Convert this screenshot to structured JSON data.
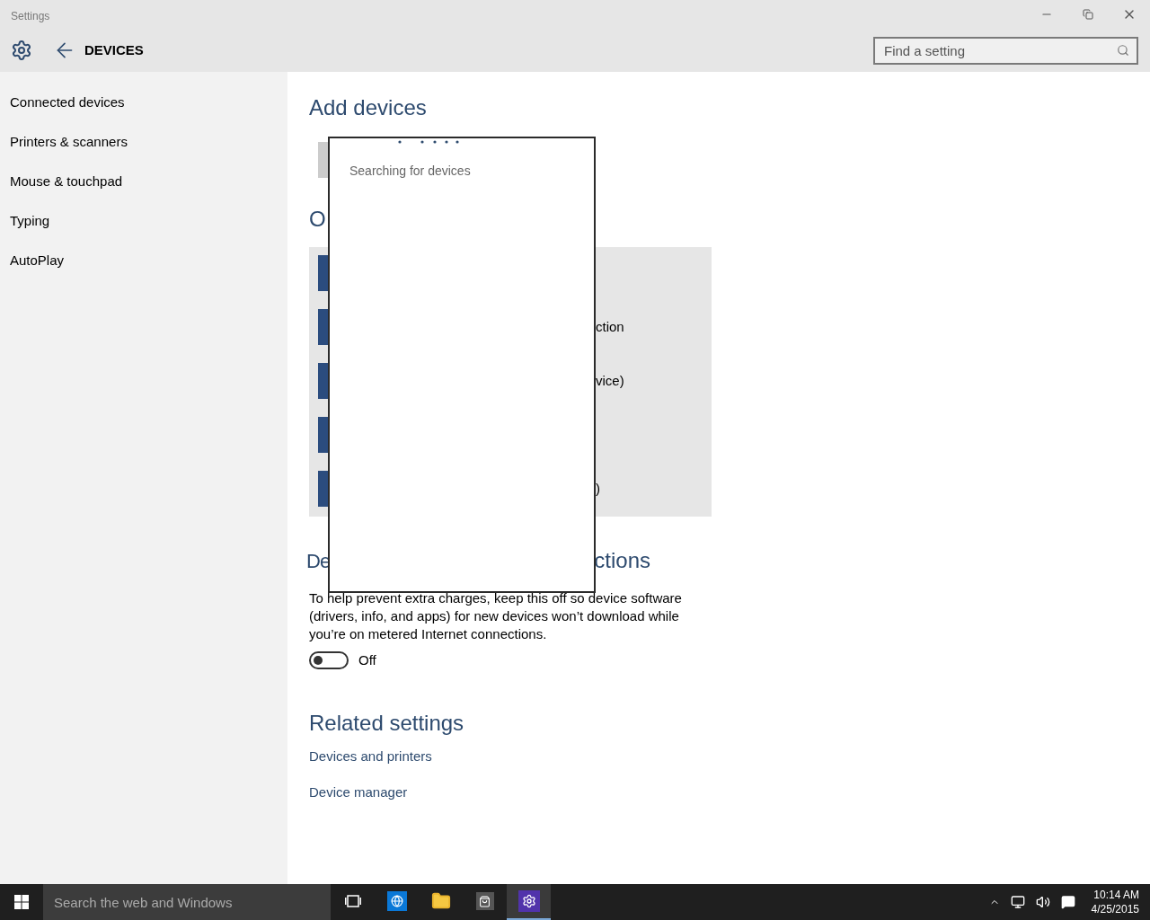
{
  "window": {
    "title": "Settings"
  },
  "header": {
    "title": "DEVICES"
  },
  "search": {
    "placeholder": "Find a setting"
  },
  "sidebar": {
    "items": [
      {
        "label": "Connected devices",
        "selected": false
      },
      {
        "label": "Printers & scanners",
        "selected": false
      },
      {
        "label": "Mouse & touchpad",
        "selected": false
      },
      {
        "label": "Typing",
        "selected": false
      },
      {
        "label": "AutoPlay",
        "selected": false
      }
    ]
  },
  "content": {
    "add_devices": {
      "title": "Add devices"
    },
    "other_devices": {
      "title": "O",
      "rows": [
        {},
        {
          "text": "ction"
        },
        {
          "text": "vice)"
        },
        {},
        {
          "text": ")"
        }
      ]
    },
    "metered": {
      "title_start": "De",
      "title_end": "ctions",
      "text": "To help prevent extra charges, keep this off so device software (drivers, info, and apps) for new devices won’t download while you’re on metered Internet connections.",
      "toggle": {
        "on": false,
        "label": "Off"
      }
    },
    "related": {
      "title": "Related settings",
      "links": [
        "Devices and printers",
        "Device manager"
      ]
    }
  },
  "dialog": {
    "status": "Searching for devices"
  },
  "taskbar": {
    "search_placeholder": "Search the web and Windows",
    "apps": [
      {
        "kind": "task-view",
        "selected": false
      },
      {
        "kind": "browser",
        "selected": false
      },
      {
        "kind": "explorer",
        "selected": false
      },
      {
        "kind": "store",
        "selected": false
      },
      {
        "kind": "settings",
        "selected": true
      }
    ],
    "clock": {
      "time": "10:14 AM",
      "date": "4/25/2015"
    }
  }
}
